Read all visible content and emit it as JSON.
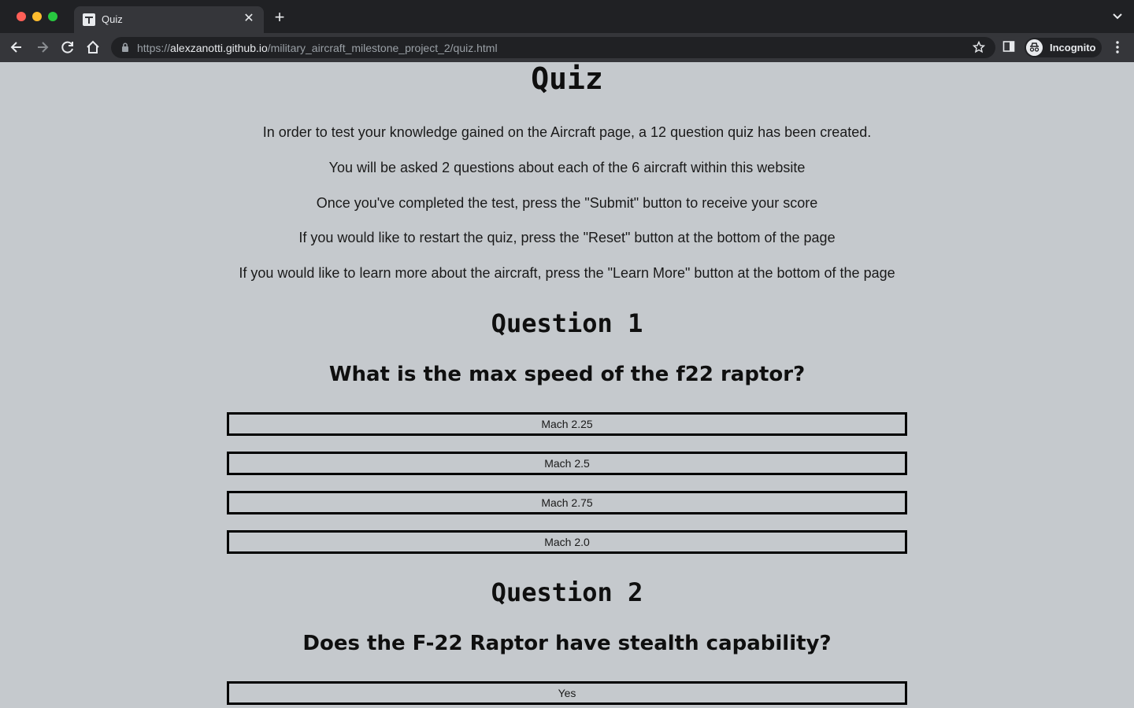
{
  "browser": {
    "tab_title": "Quiz",
    "url_scheme": "https://",
    "url_host": "alexzanotti.github.io",
    "url_path": "/military_aircraft_milestone_project_2/quiz.html",
    "profile_label": "Incognito"
  },
  "page": {
    "title": "Quiz",
    "intro": [
      "In order to test your knowledge gained on the Aircraft page, a 12 question quiz has been created.",
      "You will be asked 2 questions about each of the 6 aircraft within this website",
      "Once you've completed the test, press the \"Submit\" button to receive your score",
      "If you would like to restart the quiz, press the \"Reset\" button at the bottom of the page",
      "If you would like to learn more about the aircraft, press the \"Learn More\" button at the bottom of the page"
    ],
    "questions": [
      {
        "heading": "Question 1",
        "text": "What is the max speed of the f22 raptor?",
        "answers": [
          "Mach 2.25",
          "Mach 2.5",
          "Mach 2.75",
          "Mach 2.0"
        ]
      },
      {
        "heading": "Question 2",
        "text": "Does the F-22 Raptor have stealth capability?",
        "answers": [
          "Yes"
        ]
      }
    ]
  }
}
